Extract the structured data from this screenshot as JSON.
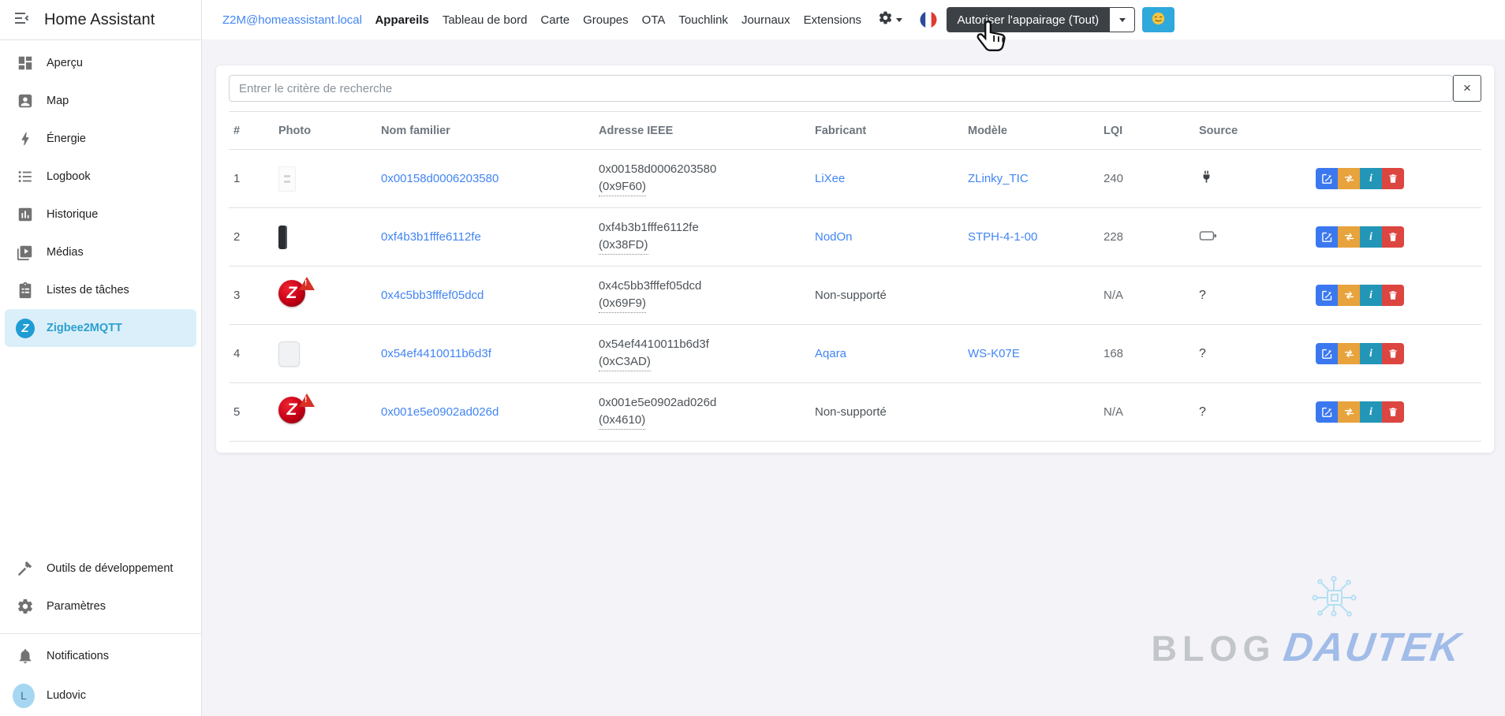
{
  "sidebar": {
    "title": "Home Assistant",
    "menu_icon": "menu-open-icon",
    "items": [
      {
        "label": "Aperçu",
        "icon": "view-dashboard-icon",
        "active": false
      },
      {
        "label": "Map",
        "icon": "account-box-icon",
        "active": false
      },
      {
        "label": "Énergie",
        "icon": "lightning-bolt-icon",
        "active": false
      },
      {
        "label": "Logbook",
        "icon": "list-bulleted-icon",
        "active": false
      },
      {
        "label": "Historique",
        "icon": "chart-box-icon",
        "active": false
      },
      {
        "label": "Médias",
        "icon": "play-box-icon",
        "active": false
      },
      {
        "label": "Listes de tâches",
        "icon": "clipboard-list-icon",
        "active": false
      },
      {
        "label": "Zigbee2MQTT",
        "icon": "zigbee2mqtt-icon",
        "active": true
      }
    ],
    "bottom_items": [
      {
        "label": "Outils de développement",
        "icon": "hammer-icon"
      },
      {
        "label": "Paramètres",
        "icon": "gear-icon"
      }
    ],
    "notifications_label": "Notifications",
    "notifications_icon": "bell-icon",
    "user": {
      "name": "Ludovic",
      "avatar_letter": "L"
    }
  },
  "topbar": {
    "bridge_link": "Z2M@homeassistant.local",
    "tabs": [
      {
        "label": "Appareils",
        "active": true
      },
      {
        "label": "Tableau de bord",
        "active": false
      },
      {
        "label": "Carte",
        "active": false
      },
      {
        "label": "Groupes",
        "active": false
      },
      {
        "label": "OTA",
        "active": false
      },
      {
        "label": "Touchlink",
        "active": false
      },
      {
        "label": "Journaux",
        "active": false
      },
      {
        "label": "Extensions",
        "active": false
      }
    ],
    "settings_icon": "gear-icon",
    "language_flag_icon": "french-flag-icon",
    "permit_join_label": "Autoriser l'appairage (Tout)",
    "permit_join_caret_icon": "chevron-down-icon",
    "emoji_button_icon": "smiley-icon"
  },
  "search": {
    "placeholder": "Entrer le critère de recherche",
    "clear_glyph": "×"
  },
  "table": {
    "columns": [
      "#",
      "Photo",
      "Nom familier",
      "Adresse IEEE",
      "Fabricant",
      "Modèle",
      "LQI",
      "Source"
    ],
    "action_icons": [
      "edit-icon",
      "reconfigure-icon",
      "info-icon",
      "delete-icon"
    ],
    "info_glyph": "i",
    "rows": [
      {
        "num": "1",
        "photo_icon": "zlinky-device-photo",
        "name": "0x00158d0006203580",
        "ieee": "0x00158d0006203580",
        "short_addr": "(0x9F60)",
        "vendor": "LiXee",
        "model": "ZLinky_TIC",
        "lqi": "240",
        "source_icon": "power-plug-icon",
        "source_glyph": ""
      },
      {
        "num": "2",
        "photo_icon": "nodon-device-photo",
        "name": "0xf4b3b1fffe6112fe",
        "ieee": "0xf4b3b1fffe6112fe",
        "short_addr": "(0x38FD)",
        "vendor": "NodOn",
        "model": "STPH-4-1-00",
        "lqi": "228",
        "source_icon": "battery-icon",
        "source_glyph": ""
      },
      {
        "num": "3",
        "photo_icon": "unsupported-device-photo",
        "name": "0x4c5bb3fffef05dcd",
        "ieee": "0x4c5bb3fffef05dcd",
        "short_addr": "(0x69F9)",
        "vendor": "Non-supporté",
        "model": "",
        "lqi": "N/A",
        "source_icon": "",
        "source_glyph": "?"
      },
      {
        "num": "4",
        "photo_icon": "aqara-device-photo",
        "name": "0x54ef4410011b6d3f",
        "ieee": "0x54ef4410011b6d3f",
        "short_addr": "(0xC3AD)",
        "vendor": "Aqara",
        "model": "WS-K07E",
        "lqi": "168",
        "source_icon": "",
        "source_glyph": "?"
      },
      {
        "num": "5",
        "photo_icon": "unsupported-device-photo",
        "name": "0x001e5e0902ad026d",
        "ieee": "0x001e5e0902ad026d",
        "short_addr": "(0x4610)",
        "vendor": "Non-supporté",
        "model": "",
        "lqi": "N/A",
        "source_icon": "",
        "source_glyph": "?"
      }
    ],
    "unsupported_warning_glyph": "!",
    "z2m_logo_glyph": "Z"
  },
  "watermark": {
    "text1": "BLOG",
    "text2": "DAUTEK",
    "icon": "circuit-chip-icon"
  },
  "colors": {
    "sidebar_active_bg": "#dbeffa",
    "sidebar_active_text": "#2ba0ce",
    "link_blue": "#4285f4",
    "permit_button_bg": "#3c4146",
    "emoji_button_bg": "#2fa8dc",
    "action_edit": "#3b78f0",
    "action_reconfigure": "#e8a33c",
    "action_info": "#2396b8",
    "action_delete": "#dc4540",
    "unsupported_red": "#c40016",
    "warning_red": "#d93025",
    "avatar_bg": "#a5d7f2",
    "main_bg": "#f4f3f8"
  }
}
